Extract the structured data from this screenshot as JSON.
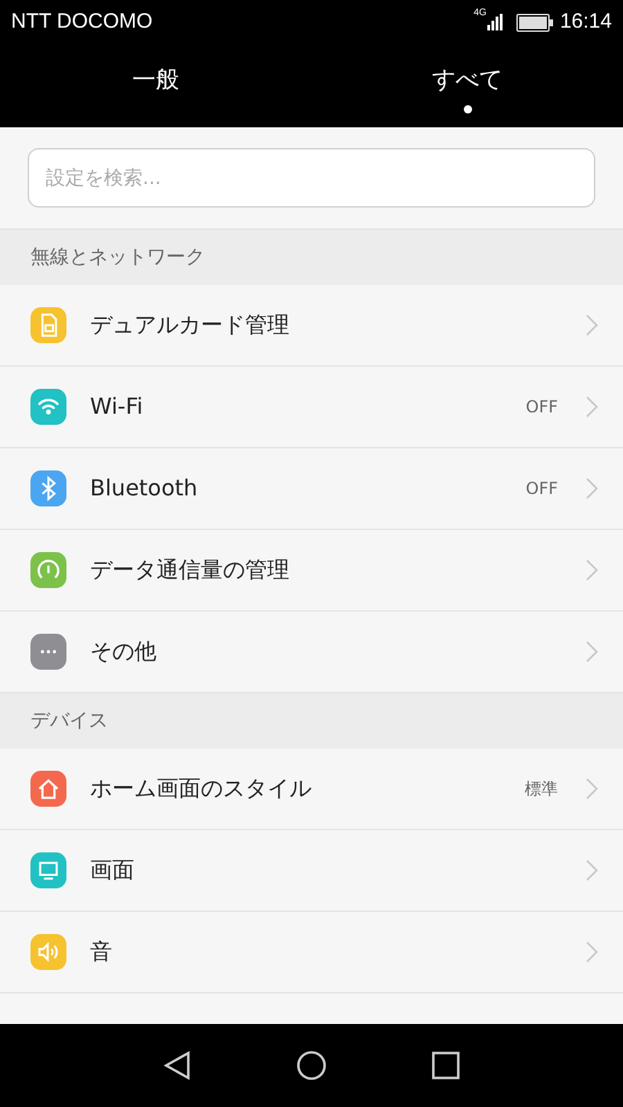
{
  "status_bar": {
    "carrier": "NTT DOCOMO",
    "network": "4G",
    "time": "16:14"
  },
  "tabs": [
    {
      "label": "一般",
      "selected": false
    },
    {
      "label": "すべて",
      "selected": true
    }
  ],
  "search": {
    "placeholder": "設定を検索..."
  },
  "sections": [
    {
      "title": "無線とネットワーク",
      "items": [
        {
          "label": "デュアルカード管理",
          "color": "#f6c230"
        },
        {
          "label": "Wi-Fi",
          "value": "OFF",
          "color": "#22c1c3"
        },
        {
          "label": "Bluetooth",
          "value": "OFF",
          "color": "#4aa6f0"
        },
        {
          "label": "データ通信量の管理",
          "color": "#7cc24a"
        },
        {
          "label": "その他",
          "color": "#8e8e93"
        }
      ]
    },
    {
      "title": "デバイス",
      "items": [
        {
          "label": "ホーム画面のスタイル",
          "value": "標準",
          "color": "#f4694d"
        },
        {
          "label": "画面",
          "color": "#22c1c3"
        },
        {
          "label": "音",
          "color": "#f6c230"
        }
      ]
    }
  ]
}
